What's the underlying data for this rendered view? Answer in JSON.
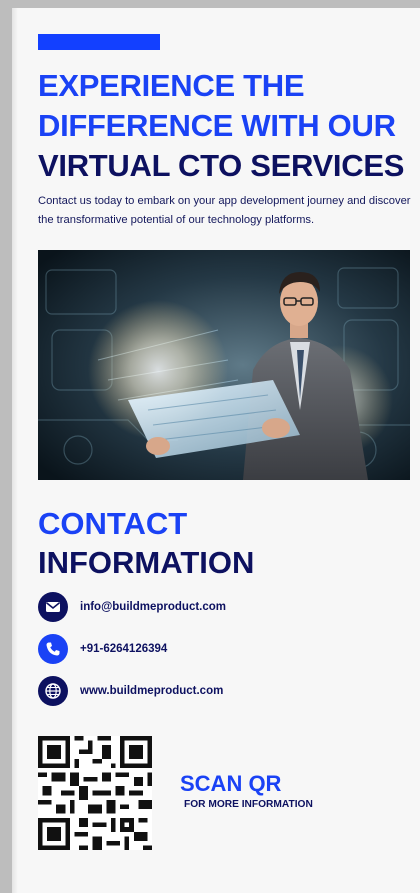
{
  "brochure": {
    "headline": {
      "line1": "EXPERIENCE THE",
      "line2": "DIFFERENCE WITH OUR",
      "line3": "VIRTUAL CTO SERVICES"
    },
    "intro_text": "Contact us today to embark on your app development journey and discover the transformative potential of our technology platforms.",
    "hero_image": {
      "icon": "businessman-holographic-screen-image"
    },
    "contact": {
      "title_line1": "CONTACT",
      "title_line2": "INFORMATION",
      "items": [
        {
          "icon": "mail-icon",
          "value": "info@buildmeproduct.com"
        },
        {
          "icon": "phone-icon",
          "value": "+91-6264126394"
        },
        {
          "icon": "globe-icon",
          "value": "www.buildmeproduct.com"
        }
      ]
    },
    "qr": {
      "icon": "qr-code",
      "title": "SCAN QR",
      "subtitle": "FOR MORE INFORMATION"
    }
  },
  "colors": {
    "accent_blue": "#1a42f5",
    "navy": "#0d1160",
    "page_bg": "#f7f7f7",
    "frame_bg": "#bdbdbd"
  }
}
